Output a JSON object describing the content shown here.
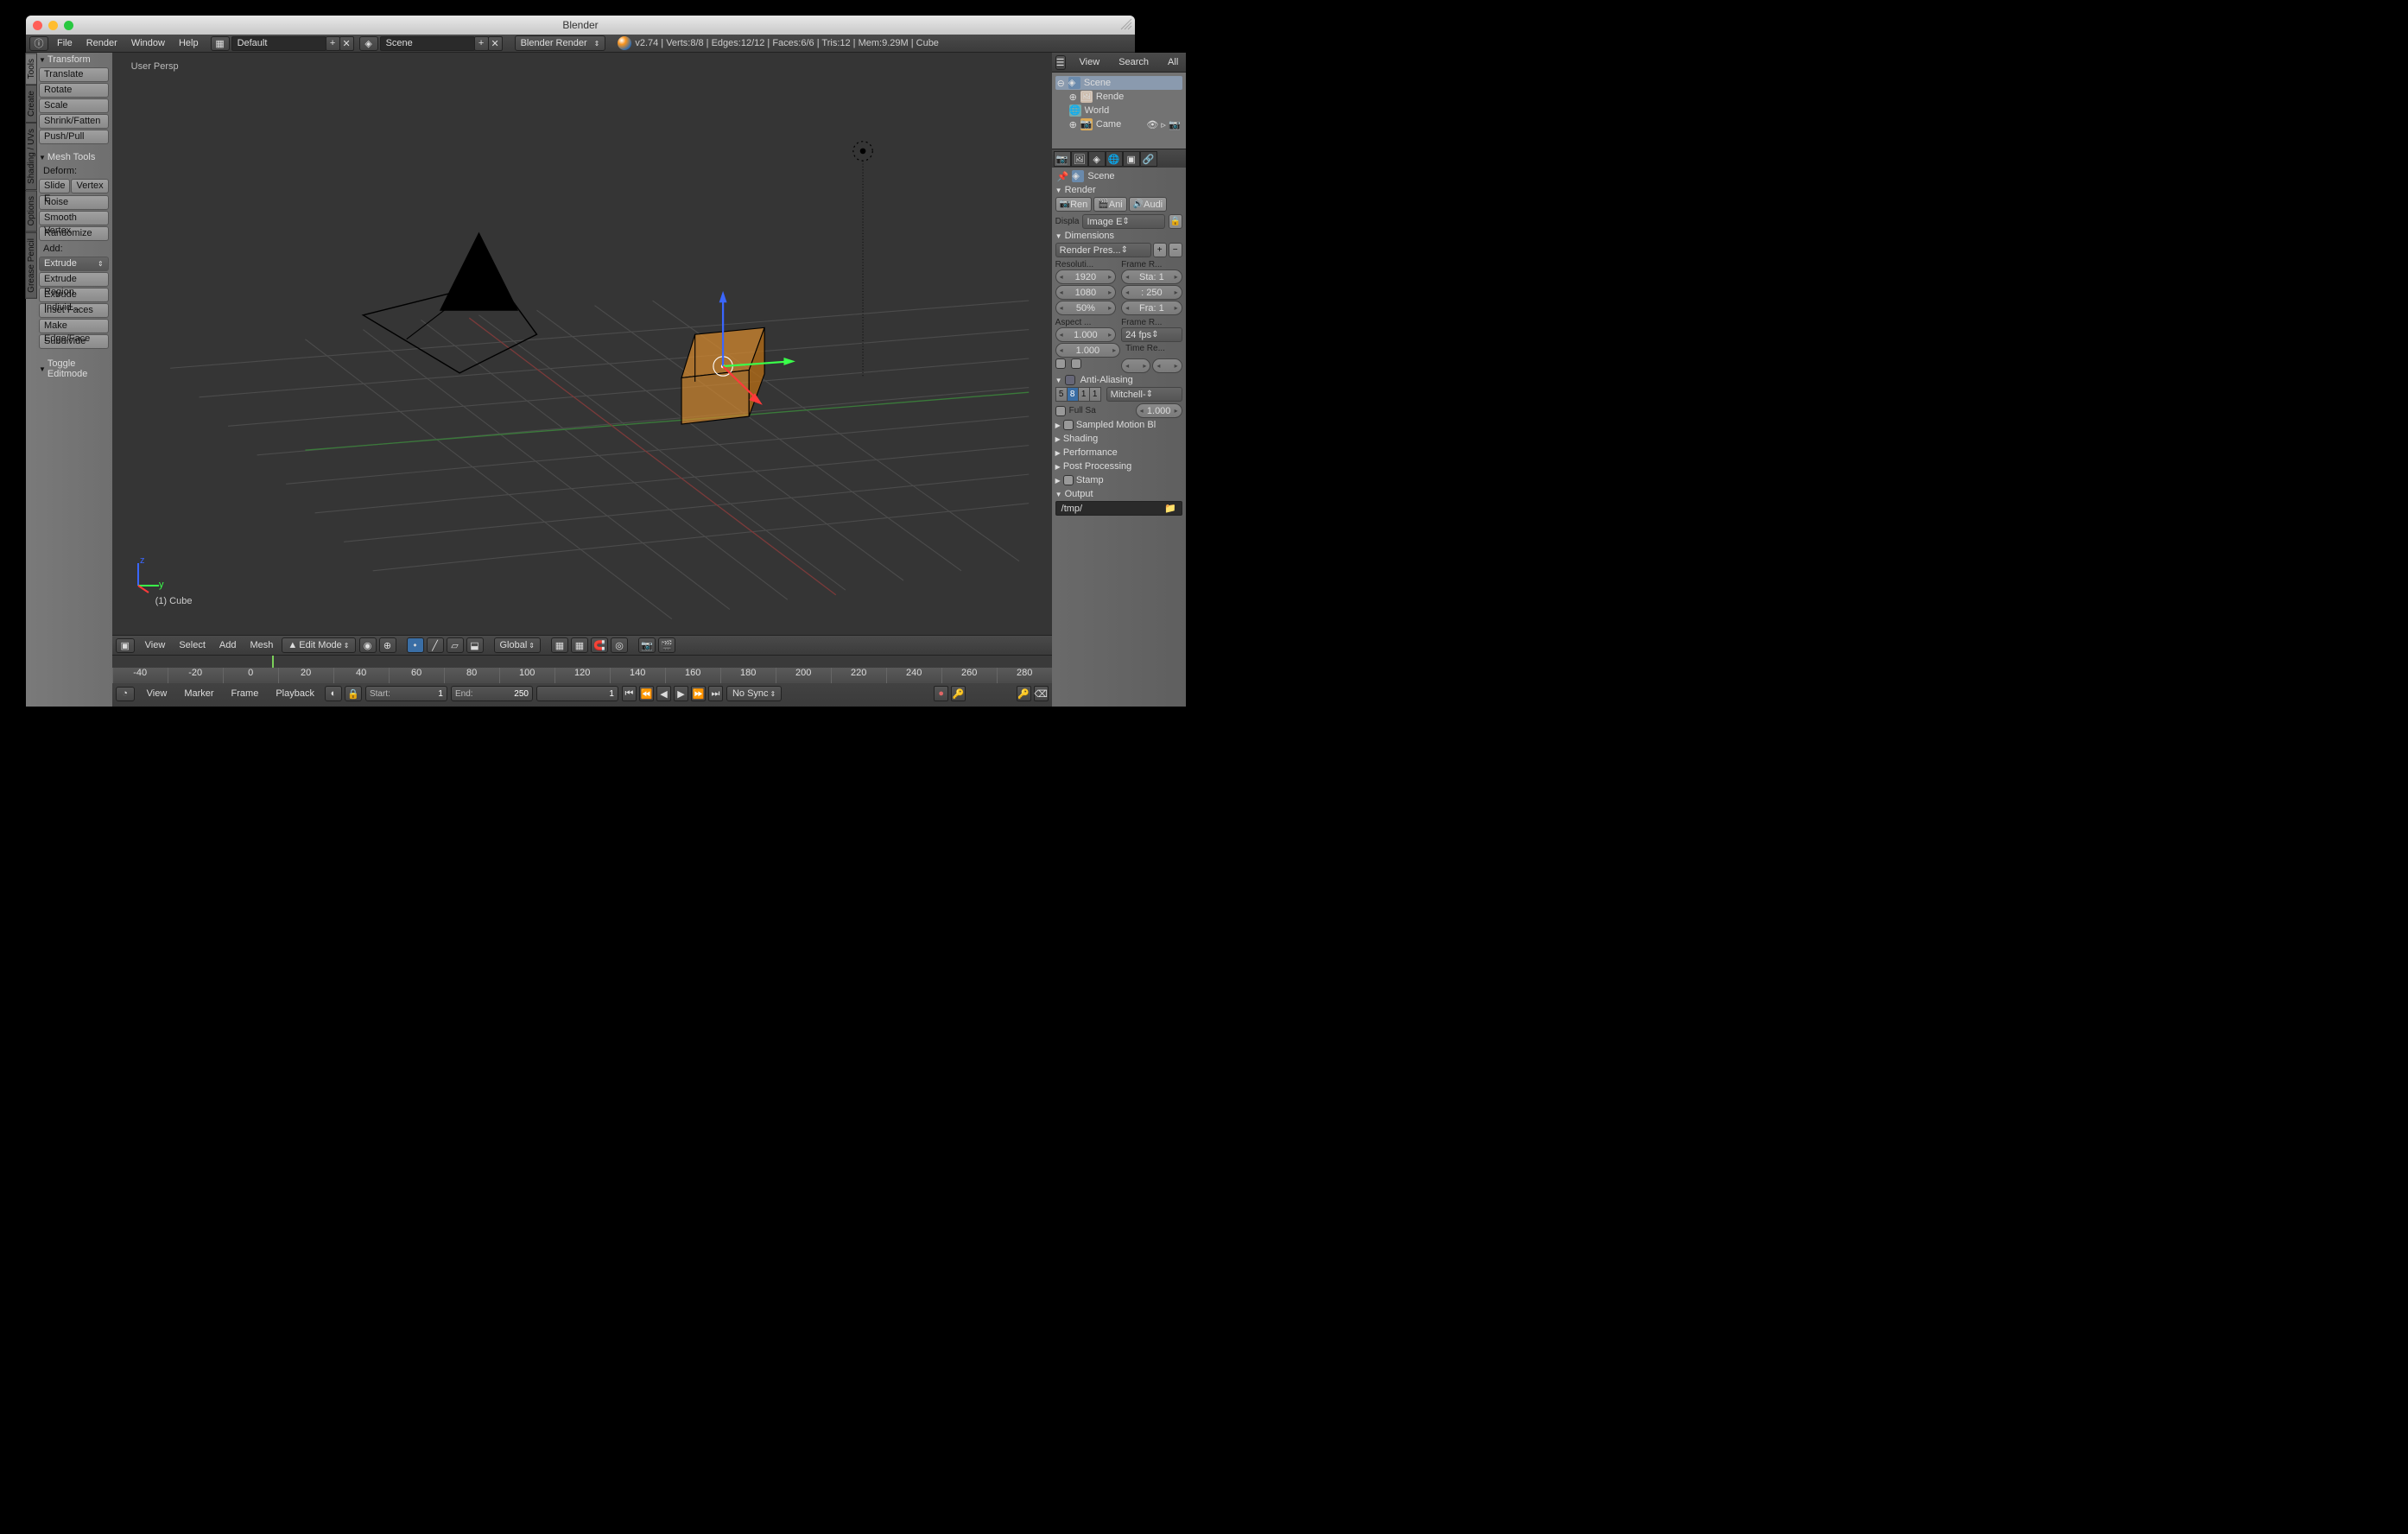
{
  "window_title": "Blender",
  "top_menu": {
    "items": [
      "File",
      "Render",
      "Window",
      "Help"
    ],
    "layout": "Default",
    "scene": "Scene",
    "engine": "Blender Render",
    "status": "v2.74 | Verts:8/8 | Edges:12/12 | Faces:6/6 | Tris:12 | Mem:9.29M | Cube"
  },
  "left_tabs": [
    "Tools",
    "Create",
    "Shading / UVs",
    "Options",
    "Grease Pencil"
  ],
  "transform": {
    "title": "Transform",
    "buttons": [
      "Translate",
      "Rotate",
      "Scale",
      "Shrink/Fatten",
      "Push/Pull"
    ]
  },
  "mesh_tools": {
    "title": "Mesh Tools",
    "deform_label": "Deform:",
    "deform": [
      "Slide E",
      "Vertex"
    ],
    "deform_more": [
      "Noise",
      "Smooth Vertex",
      "Randomize"
    ],
    "add_label": "Add:",
    "extrude": "Extrude",
    "add": [
      "Extrude Region",
      "Extrude Individ...",
      "Inset Faces",
      "Make Edge/Face",
      "Subdivide"
    ]
  },
  "toggle": {
    "title": "Toggle Editmode"
  },
  "viewport": {
    "label": "User Persp",
    "object": "(1) Cube"
  },
  "view_header": {
    "menus": [
      "View",
      "Select",
      "Add",
      "Mesh"
    ],
    "mode": "Edit Mode",
    "orientation": "Global"
  },
  "timeline": {
    "ticks": [
      "-40",
      "-20",
      "0",
      "20",
      "40",
      "60",
      "80",
      "100",
      "120",
      "140",
      "160",
      "180",
      "200",
      "220",
      "240",
      "260",
      "280"
    ],
    "menus": [
      "View",
      "Marker",
      "Frame",
      "Playback"
    ],
    "start_label": "Start:",
    "start": "1",
    "end_label": "End:",
    "end": "250",
    "current": "1",
    "sync": "No Sync"
  },
  "outliner": {
    "menus": [
      "View",
      "Search",
      "All"
    ],
    "scene": "Scene",
    "render": "Rende",
    "world": "World",
    "camera": "Came"
  },
  "scene_label": "Scene",
  "render": {
    "title": "Render",
    "ren": "Ren",
    "ani": "Ani",
    "audi": "Audi",
    "displa": "Displa",
    "image_e": "Image E"
  },
  "dimensions": {
    "title": "Dimensions",
    "preset": "Render Pres...",
    "reso_label": "Resoluti...",
    "fr_label": "Frame R...",
    "res_x": "1920",
    "res_y": "1080",
    "res_pct": "50%",
    "sta": "Sta: 1",
    "end": ": 250",
    "fra": "Fra: 1",
    "aspect_label": "Aspect ...",
    "fr2_label": "Frame R...",
    "asp_x": "1.000",
    "asp_y": "1.000",
    "fps": "24 fps",
    "time_label": "Time Re..."
  },
  "aa": {
    "title": "Anti-Aliasing",
    "samples": [
      "5",
      "8",
      "1",
      "1"
    ],
    "filter": "Mitchell-",
    "full_sa": "Full Sa",
    "full_val": "1.000"
  },
  "closed_panels": [
    "Sampled Motion Bl",
    "Shading",
    "Performance",
    "Post Processing",
    "Stamp",
    "Output"
  ],
  "output_path": "/tmp/"
}
